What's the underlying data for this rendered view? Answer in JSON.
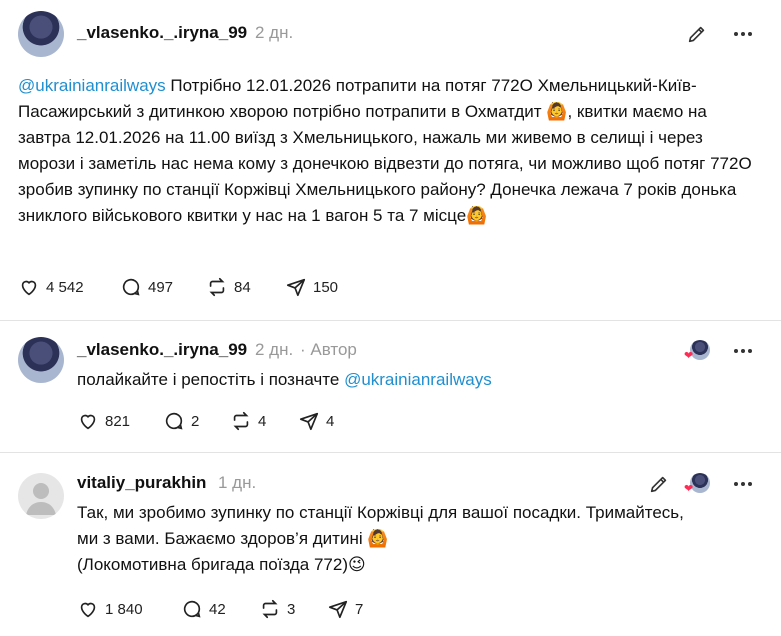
{
  "posts": [
    {
      "username": "_vlasenko._.iryna_99",
      "time": "2 дн.",
      "mention": "@ukrainianrailways",
      "text": " Потрібно 12.01.2026 потрапити на потяг 772О Хмельницький-Київ-Пасажирський з дитинкою хворою потрібно потрапити в Охматдит 🙆, квитки маємо на завтра 12.01.2026 на 11.00 виїзд з Хмельницького, нажаль ми живемо в селищі і через морози і заметіль нас нема кому з донечкою відвезти до потяга, чи можливо щоб потяг 772О зробив зупинку по станції Коржівці Хмельницького району? Донечка лежача 7 років донька зниклого військового квитки у нас на 1 вагон 5 та 7 місце🙆",
      "likes": "4 542",
      "replies": "497",
      "reposts": "84",
      "shares": "150"
    },
    {
      "username": "_vlasenko._.iryna_99",
      "time": "2 дн.",
      "author_label": "· Автор",
      "text": "полайкайте і репостіть і позначте ",
      "mention": "@ukrainianrailways",
      "likes": "821",
      "replies": "2",
      "reposts": "4",
      "shares": "4"
    },
    {
      "username": "vitaliy_purakhin",
      "time": "1 дн.",
      "line1": "Так, ми зробимо зупинку по станції Коржівці для вашої посадки. Тримайтесь,",
      "line2": "ми з вами. Бажаємо здоров’я дитині 🙆",
      "line3": "(Локомотивна бригада поїзда 772)😉",
      "likes": "1 840",
      "replies": "42",
      "reposts": "3",
      "shares": "7"
    }
  ],
  "colors": {
    "mention": "#1f8fd0",
    "heart": "#ff2d55",
    "muted": "#999999"
  }
}
